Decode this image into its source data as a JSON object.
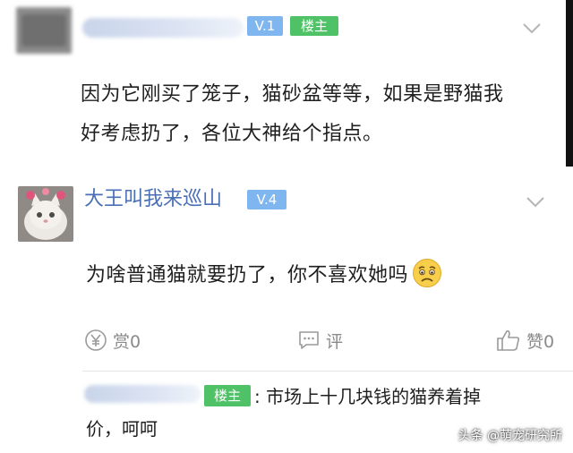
{
  "post1": {
    "level_badge": "V.1",
    "op_badge": "楼主",
    "content_line1": "因为它刚买了笼子，猫砂盆等等，如果是野猫我",
    "content_line2": "好考虑扔了，各位大神给个指点。"
  },
  "post2": {
    "username": "大王叫我来巡山",
    "level_badge": "V.4",
    "content": "为啥普通猫就要扔了，你不喜欢她吗",
    "actions": {
      "reward_label": "赏0",
      "comment_label": "评",
      "like_label": "赞0"
    }
  },
  "reply": {
    "op_badge": "楼主",
    "text_line1": ": 市场上十几块钱的猫养着掉",
    "text_line2": "价，呵呵"
  },
  "watermark": "头条 @萌宠研究所",
  "colors": {
    "username_blue": "#4a6fb5",
    "level_badge_blue": "#7fb6ef",
    "op_badge_green": "#4fc267",
    "action_gray": "#8a8a8a"
  }
}
